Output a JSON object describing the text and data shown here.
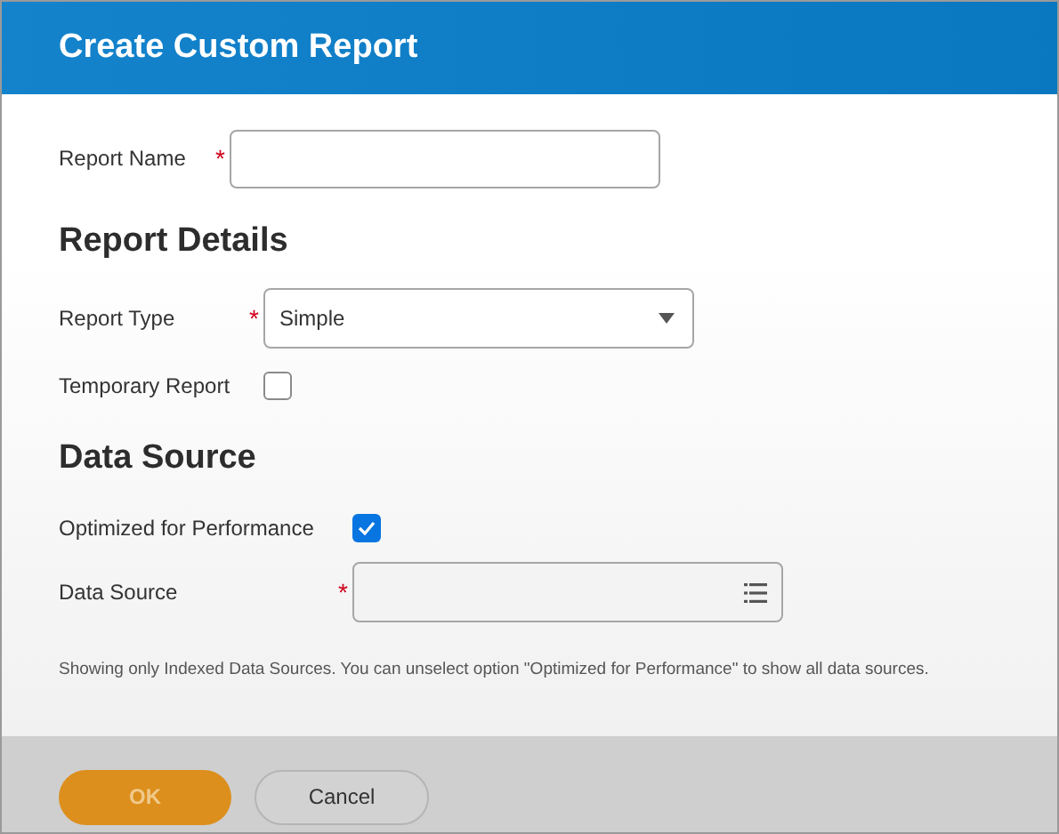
{
  "dialog": {
    "title": "Create Custom Report"
  },
  "sections": [
    {
      "fields": [
        {
          "kind": "text",
          "label": "Report Name",
          "required_mark": "*"
        }
      ]
    },
    {
      "heading": "Report Details",
      "fields": [
        {
          "kind": "select",
          "label": "Report Type",
          "required_mark": "*",
          "value": "Simple"
        },
        {
          "kind": "checkbox",
          "label": "Temporary Report",
          "checked": false
        }
      ]
    },
    {
      "heading": "Data Source",
      "fields": [
        {
          "kind": "checkbox",
          "label": "Optimized for Performance",
          "checked": true
        },
        {
          "kind": "lookup",
          "label": "Data Source",
          "required_mark": "*"
        }
      ]
    }
  ],
  "note": "Showing only Indexed Data Sources. You can unselect option \"Optimized for Performance\" to show all data sources.",
  "buttons": [
    {
      "kind": "primary",
      "label": "OK",
      "disabled": true
    },
    {
      "kind": "secondary",
      "label": "Cancel",
      "disabled": false
    }
  ]
}
